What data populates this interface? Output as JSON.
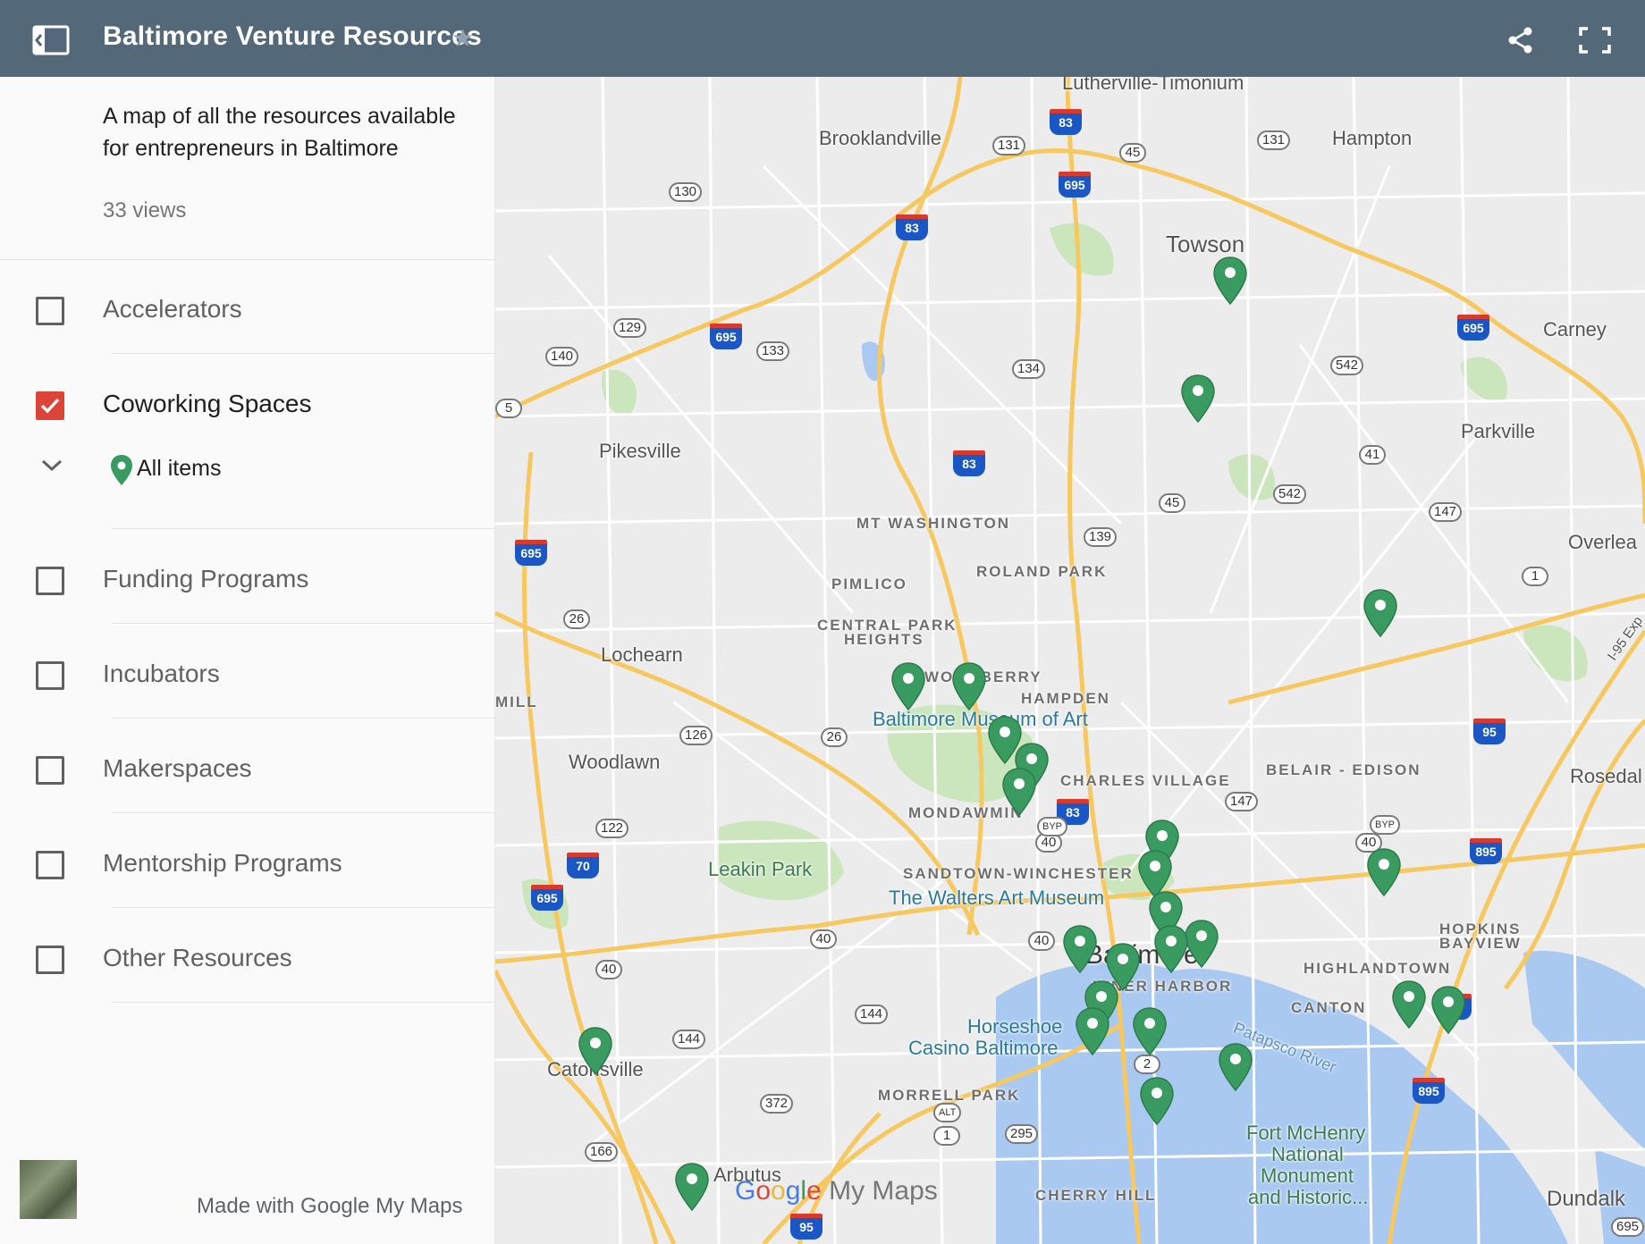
{
  "header": {
    "title": "Baltimore Venture Resources"
  },
  "sidebar": {
    "description": "A map of all the resources available for entrepreneurs in Baltimore",
    "views": "33 views",
    "layers": [
      {
        "label": "Accelerators",
        "checked": false
      },
      {
        "label": "Coworking Spaces",
        "checked": true
      },
      {
        "label": "Funding Programs",
        "checked": false
      },
      {
        "label": "Incubators",
        "checked": false
      },
      {
        "label": "Makerspaces",
        "checked": false
      },
      {
        "label": "Mentorship Programs",
        "checked": false
      },
      {
        "label": "Other Resources",
        "checked": false
      }
    ],
    "sublayer_label": "All items",
    "footer": "Made with Google My Maps"
  },
  "map": {
    "places": {
      "lutherville": "Lutherville-Timonium",
      "brooklandville": "Brooklandville",
      "hampton": "Hampton",
      "towson": "Towson",
      "carney": "Carney",
      "pikesville": "Pikesville",
      "parkville": "Parkville",
      "overlea": "Overlea",
      "lochearn": "Lochearn",
      "woodlawn": "Woodlawn",
      "rosedale": "Rosedal",
      "catonsville": "Catonsville",
      "arbutus": "Arbutus",
      "dundalk": "Dundalk",
      "baltimore": "Baltimore",
      "leakin_park": "Leakin Park"
    },
    "neighborhoods": {
      "mt_washington": "MT WASHINGTON",
      "roland_park": "ROLAND PARK",
      "pimlico": "PIMLICO",
      "central_park_1": "CENTRAL PARK",
      "central_park_2": "HEIGHTS",
      "woodberry": "WOODBERRY",
      "hampden": "HAMPDEN",
      "charles_village": "CHARLES VILLAGE",
      "mondawmin": "MONDAWMIN",
      "belair_edison": "BELAIR - EDISON",
      "sandtown": "SANDTOWN-WINCHESTER",
      "inner_harbor": "INNER HARBOR",
      "highlandtown": "HIGHLANDTOWN",
      "canton": "CANTON",
      "hopkins_1": "HOPKINS",
      "hopkins_2": "BAYVIEW",
      "morrell_park": "MORRELL PARK",
      "cherry_hill": "CHERRY HILL",
      "mill": "MILL"
    },
    "pois": {
      "bma": "Baltimore Museum of Art",
      "walters": "The Walters Art Museum",
      "horseshoe_1": "Horseshoe",
      "horseshoe_2": "Casino Baltimore",
      "fort_1": "Fort McHenry",
      "fort_2": "National",
      "fort_3": "Monument",
      "fort_4": "and Historic...",
      "patapsco": "Patapsco River",
      "i95exp": "I-95 Exp"
    },
    "routes": {
      "r83": "83",
      "r695": "695",
      "r131": "131",
      "r45": "45",
      "r130": "130",
      "r129": "129",
      "r133": "133",
      "r140": "140",
      "r134": "134",
      "r542": "542",
      "r41": "41",
      "r147": "147",
      "r139": "139",
      "r1": "1",
      "r26": "26",
      "r126": "126",
      "r122": "122",
      "r70": "70",
      "r40": "40",
      "byp": "BYP",
      "r144": "144",
      "r372": "372",
      "r166": "166",
      "r95": "95",
      "r895": "895",
      "r2": "2",
      "r295": "295",
      "alt": "ALT",
      "r5": "5"
    },
    "attribution": {
      "g": "G",
      "o1": "o",
      "o2": "o",
      "g2": "g",
      "l": "l",
      "e": "e",
      "suffix": " My Maps"
    }
  },
  "colors": {
    "header_bg": "#536878",
    "checkbox_checked": "#db4437",
    "pin": "#3a9b60",
    "road": "#f6c85f",
    "water": "#a9c9f1",
    "park": "#cbe6bd"
  }
}
